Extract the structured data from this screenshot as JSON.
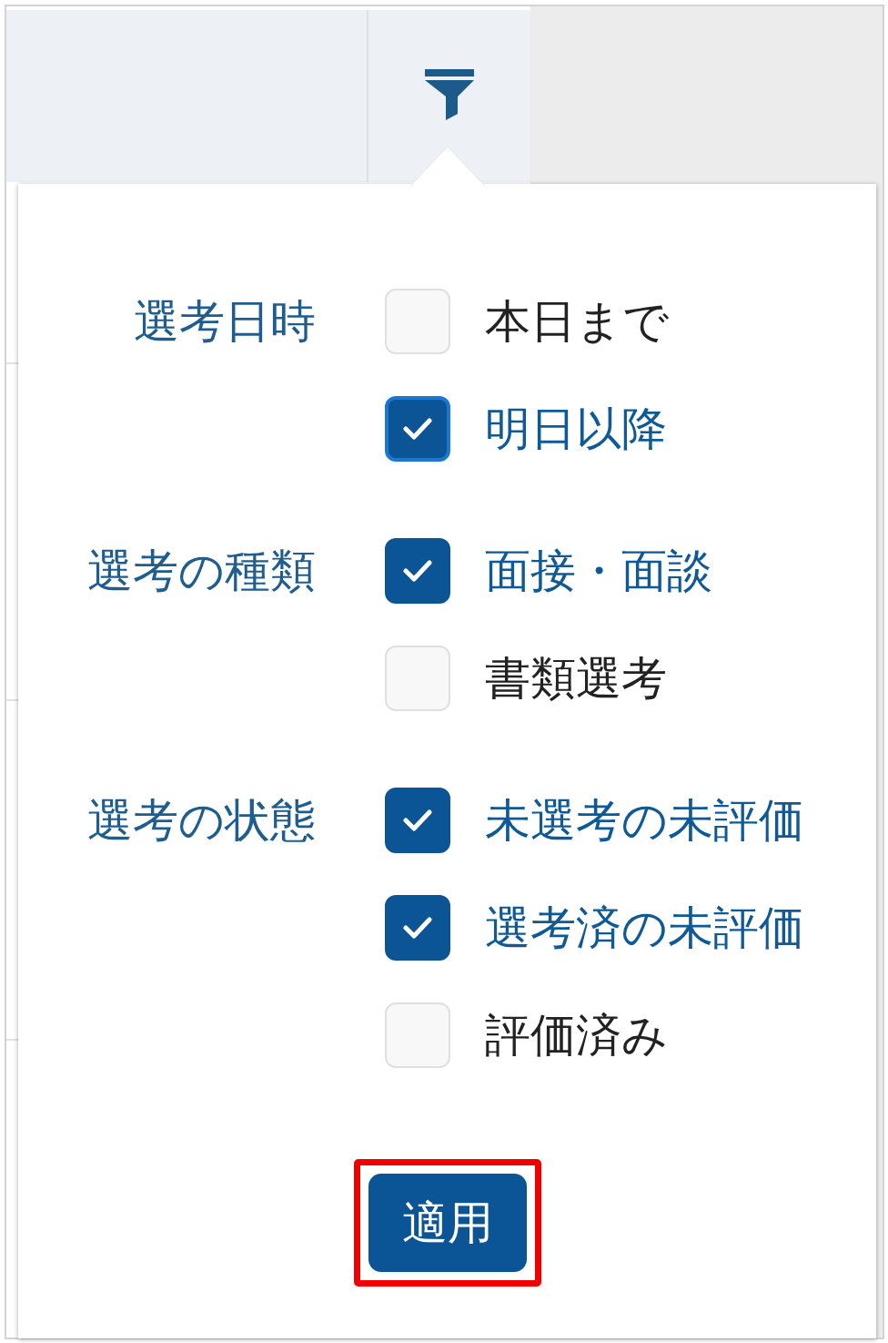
{
  "filter_popup": {
    "sections": [
      {
        "label": "選考日時",
        "options": [
          {
            "label": "本日まで",
            "checked": false,
            "focused": false
          },
          {
            "label": "明日以降",
            "checked": true,
            "focused": true
          }
        ]
      },
      {
        "label": "選考の種類",
        "options": [
          {
            "label": "面接・面談",
            "checked": true,
            "focused": false
          },
          {
            "label": "書類選考",
            "checked": false,
            "focused": false
          }
        ]
      },
      {
        "label": "選考の状態",
        "options": [
          {
            "label": "未選考の未評価",
            "checked": true,
            "focused": false
          },
          {
            "label": "選考済の未評価",
            "checked": true,
            "focused": false
          },
          {
            "label": "評価済み",
            "checked": false,
            "focused": false
          }
        ]
      }
    ],
    "apply_button": {
      "label": "適用",
      "highlighted": true
    }
  }
}
